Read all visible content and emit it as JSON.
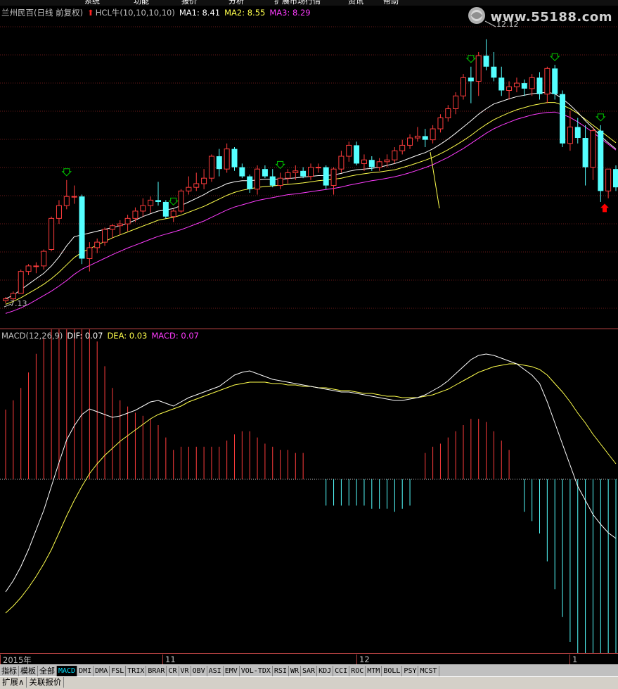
{
  "topbar": {
    "items": [
      "系统",
      "功能",
      "报价",
      "分析",
      "扩展市场行情",
      "资讯",
      "帮助"
    ]
  },
  "price_panel": {
    "stock_name": "兰州民百(日线 前复权)",
    "indicator": "HCL牛(10,10,10,10)",
    "ma1_label": "MA1: 8.41",
    "ma2_label": "MA2: 8.55",
    "ma3_label": "MA3: 8.29",
    "high_label": "12.12",
    "low_label": "7.13",
    "watermark": "www.55188.com"
  },
  "macd_panel": {
    "name": "MACD(12,26,9)",
    "dif_label": "DIF: 0.07",
    "dea_label": "DEA: 0.03",
    "macd_label": "MACD: 0.07"
  },
  "time_axis": {
    "labels": [
      "2015年",
      "11",
      "12",
      "1"
    ]
  },
  "tabs": [
    "指标",
    "模板",
    "全部",
    "MACD",
    "DMI",
    "DMA",
    "FSL",
    "TRIX",
    "BRAR",
    "CR",
    "VR",
    "OBV",
    "ASI",
    "EMV",
    "VOL-TDX",
    "RSI",
    "WR",
    "SAR",
    "KDJ",
    "CCI",
    "ROC",
    "MTM",
    "BOLL",
    "PSY",
    "MCST"
  ],
  "active_tab": "MACD",
  "bottom_buttons": [
    "扩展∧",
    "关联报价"
  ],
  "colors": {
    "up": "#ff3c3c",
    "down": "#54ffff",
    "ma1": "#ffffff",
    "ma2": "#ffff4c",
    "ma3": "#ff3cff",
    "grid": "#6a1a1a",
    "buy_arrow": "#00c800",
    "sell_arrow": "#ff0000"
  },
  "chart_data": [
    {
      "type": "candlestick",
      "title": "兰州民百(日线 前复权)",
      "candles": [
        [
          7.2,
          7.3,
          7.13,
          7.25
        ],
        [
          7.25,
          7.45,
          7.2,
          7.4
        ],
        [
          7.4,
          8.05,
          7.4,
          8.0
        ],
        [
          8.0,
          8.2,
          7.9,
          8.15
        ],
        [
          8.15,
          8.25,
          7.95,
          8.15
        ],
        [
          8.15,
          8.6,
          8.05,
          8.55
        ],
        [
          8.6,
          9.5,
          8.55,
          9.45
        ],
        [
          9.45,
          9.95,
          9.3,
          9.8
        ],
        [
          9.8,
          10.5,
          9.7,
          10.05
        ],
        [
          10.05,
          10.35,
          9.85,
          10.05
        ],
        [
          10.05,
          10.1,
          8.2,
          8.35
        ],
        [
          8.35,
          8.8,
          8.0,
          8.65
        ],
        [
          8.65,
          8.9,
          8.5,
          8.8
        ],
        [
          8.8,
          9.2,
          8.7,
          9.15
        ],
        [
          9.15,
          9.3,
          8.9,
          9.25
        ],
        [
          9.25,
          9.4,
          9.0,
          9.3
        ],
        [
          9.3,
          9.55,
          9.1,
          9.45
        ],
        [
          9.45,
          9.75,
          9.35,
          9.65
        ],
        [
          9.65,
          10.0,
          9.5,
          9.8
        ],
        [
          9.8,
          10.05,
          9.6,
          9.95
        ],
        [
          9.95,
          10.45,
          9.8,
          9.9
        ],
        [
          9.9,
          9.95,
          9.45,
          9.5
        ],
        [
          9.5,
          9.7,
          9.35,
          9.65
        ],
        [
          9.65,
          10.25,
          9.6,
          10.2
        ],
        [
          10.2,
          10.6,
          10.1,
          10.3
        ],
        [
          10.3,
          10.7,
          10.2,
          10.4
        ],
        [
          10.4,
          10.8,
          10.25,
          10.55
        ],
        [
          10.55,
          11.2,
          10.45,
          11.15
        ],
        [
          11.15,
          11.35,
          10.6,
          10.8
        ],
        [
          10.8,
          11.5,
          10.7,
          11.35
        ],
        [
          11.35,
          11.4,
          10.75,
          10.85
        ],
        [
          10.85,
          10.95,
          10.55,
          10.6
        ],
        [
          10.6,
          10.65,
          10.15,
          10.25
        ],
        [
          10.25,
          10.9,
          10.1,
          10.8
        ],
        [
          10.8,
          10.9,
          10.55,
          10.6
        ],
        [
          10.6,
          10.8,
          10.3,
          10.35
        ],
        [
          10.35,
          10.7,
          10.25,
          10.55
        ],
        [
          10.55,
          10.8,
          10.4,
          10.7
        ],
        [
          10.7,
          10.9,
          10.5,
          10.75
        ],
        [
          10.75,
          10.85,
          10.55,
          10.6
        ],
        [
          10.6,
          10.95,
          10.5,
          10.85
        ],
        [
          10.85,
          10.95,
          10.7,
          10.85
        ],
        [
          10.85,
          10.9,
          10.25,
          10.35
        ],
        [
          10.35,
          10.85,
          10.1,
          10.8
        ],
        [
          10.8,
          11.3,
          10.7,
          11.15
        ],
        [
          11.15,
          11.55,
          11.0,
          11.45
        ],
        [
          11.45,
          11.55,
          10.9,
          10.95
        ],
        [
          10.95,
          11.2,
          10.75,
          11.05
        ],
        [
          11.05,
          11.15,
          10.75,
          10.85
        ],
        [
          10.85,
          11.1,
          10.75,
          11.0
        ],
        [
          11.0,
          11.2,
          10.85,
          11.05
        ],
        [
          11.05,
          11.4,
          10.95,
          11.3
        ],
        [
          11.3,
          11.6,
          11.2,
          11.45
        ],
        [
          11.45,
          11.75,
          11.35,
          11.65
        ],
        [
          11.65,
          11.95,
          11.55,
          11.7
        ],
        [
          11.7,
          11.9,
          11.4,
          11.6
        ],
        [
          11.6,
          12.0,
          11.5,
          11.9
        ],
        [
          11.9,
          12.3,
          11.8,
          12.2
        ],
        [
          12.2,
          12.55,
          12.1,
          12.45
        ],
        [
          12.45,
          12.9,
          12.3,
          12.8
        ],
        [
          12.8,
          13.4,
          12.7,
          13.3
        ],
        [
          13.3,
          13.6,
          12.6,
          13.2
        ],
        [
          13.2,
          14.0,
          12.8,
          13.9
        ],
        [
          13.9,
          14.35,
          13.5,
          13.6
        ],
        [
          13.6,
          14.0,
          13.2,
          13.3
        ],
        [
          13.3,
          13.6,
          12.8,
          12.95
        ],
        [
          12.95,
          13.2,
          12.7,
          13.05
        ],
        [
          13.05,
          13.3,
          12.9,
          13.15
        ],
        [
          13.15,
          13.25,
          12.8,
          13.0
        ],
        [
          13.0,
          13.4,
          12.8,
          13.3
        ],
        [
          13.3,
          13.45,
          12.7,
          12.85
        ],
        [
          12.85,
          13.6,
          12.6,
          13.55
        ],
        [
          13.55,
          13.65,
          12.7,
          12.85
        ],
        [
          12.85,
          12.95,
          11.4,
          11.5
        ],
        [
          11.5,
          12.4,
          11.3,
          11.95
        ],
        [
          11.95,
          12.2,
          11.5,
          11.65
        ],
        [
          11.65,
          12.0,
          10.35,
          10.85
        ],
        [
          10.85,
          11.95,
          10.5,
          11.85
        ],
        [
          11.85,
          12.0,
          9.9,
          10.2
        ],
        [
          10.2,
          10.8,
          10.0,
          10.8
        ],
        [
          10.8,
          10.9,
          10.2,
          10.3
        ]
      ],
      "ma1": [
        7.25,
        7.35,
        7.5,
        7.65,
        7.8,
        7.95,
        8.15,
        8.4,
        8.7,
        8.95,
        9.0,
        9.05,
        9.1,
        9.15,
        9.2,
        9.25,
        9.32,
        9.4,
        9.5,
        9.58,
        9.65,
        9.68,
        9.72,
        9.8,
        9.9,
        10.0,
        10.1,
        10.22,
        10.3,
        10.4,
        10.45,
        10.48,
        10.48,
        10.5,
        10.52,
        10.52,
        10.52,
        10.54,
        10.56,
        10.58,
        10.6,
        10.62,
        10.62,
        10.64,
        10.68,
        10.74,
        10.78,
        10.8,
        10.82,
        10.85,
        10.9,
        10.95,
        11.02,
        11.1,
        11.18,
        11.25,
        11.35,
        11.48,
        11.62,
        11.78,
        11.95,
        12.12,
        12.3,
        12.45,
        12.58,
        12.65,
        12.72,
        12.78,
        12.82,
        12.86,
        12.88,
        12.9,
        12.86,
        12.72,
        12.55,
        12.35,
        12.12,
        11.92,
        11.7,
        11.52,
        11.35
      ],
      "ma2": [
        7.1,
        7.18,
        7.28,
        7.4,
        7.52,
        7.65,
        7.8,
        7.98,
        8.18,
        8.38,
        8.52,
        8.62,
        8.72,
        8.82,
        8.92,
        9.0,
        9.08,
        9.16,
        9.24,
        9.32,
        9.4,
        9.44,
        9.48,
        9.54,
        9.62,
        9.7,
        9.78,
        9.88,
        9.98,
        10.08,
        10.16,
        10.22,
        10.26,
        10.3,
        10.32,
        10.34,
        10.36,
        10.38,
        10.4,
        10.42,
        10.45,
        10.48,
        10.5,
        10.52,
        10.55,
        10.6,
        10.64,
        10.67,
        10.7,
        10.72,
        10.75,
        10.78,
        10.84,
        10.9,
        10.97,
        11.04,
        11.12,
        11.22,
        11.33,
        11.45,
        11.58,
        11.72,
        11.88,
        12.02,
        12.15,
        12.25,
        12.34,
        12.42,
        12.48,
        12.54,
        12.58,
        12.62,
        12.62,
        12.55,
        12.45,
        12.32,
        12.16,
        12.0,
        11.84,
        11.68,
        11.52
      ],
      "ma3": [
        6.85,
        6.92,
        7.0,
        7.1,
        7.22,
        7.34,
        7.46,
        7.6,
        7.75,
        7.92,
        8.06,
        8.16,
        8.26,
        8.36,
        8.46,
        8.55,
        8.64,
        8.72,
        8.8,
        8.88,
        8.96,
        9.02,
        9.08,
        9.14,
        9.22,
        9.3,
        9.38,
        9.48,
        9.58,
        9.68,
        9.76,
        9.82,
        9.88,
        9.94,
        9.98,
        10.02,
        10.06,
        10.1,
        10.12,
        10.15,
        10.18,
        10.21,
        10.24,
        10.27,
        10.31,
        10.36,
        10.4,
        10.44,
        10.48,
        10.51,
        10.55,
        10.59,
        10.64,
        10.7,
        10.77,
        10.84,
        10.92,
        11.02,
        11.12,
        11.24,
        11.36,
        11.5,
        11.64,
        11.78,
        11.9,
        12.0,
        12.08,
        12.16,
        12.22,
        12.28,
        12.32,
        12.35,
        12.36,
        12.3,
        12.21,
        12.09,
        11.95,
        11.8,
        11.64,
        11.48,
        11.32
      ],
      "signals": [
        [
          8,
          "buy"
        ],
        [
          36,
          "buy"
        ],
        [
          61,
          "buy"
        ],
        [
          72,
          "buy"
        ],
        [
          78,
          "buy"
        ],
        [
          103,
          "buy"
        ],
        [
          127,
          "sell"
        ]
      ],
      "price_range": [
        6.8,
        15.0
      ],
      "high": 12.12,
      "low": 7.13
    },
    {
      "type": "line+bar",
      "title": "MACD(12,26,9)",
      "dif": [
        -0.8,
        -0.72,
        -0.62,
        -0.5,
        -0.36,
        -0.22,
        -0.05,
        0.12,
        0.28,
        0.38,
        0.46,
        0.5,
        0.48,
        0.46,
        0.44,
        0.45,
        0.47,
        0.49,
        0.52,
        0.55,
        0.56,
        0.54,
        0.52,
        0.55,
        0.58,
        0.6,
        0.62,
        0.64,
        0.66,
        0.7,
        0.74,
        0.76,
        0.77,
        0.75,
        0.73,
        0.71,
        0.7,
        0.69,
        0.68,
        0.67,
        0.66,
        0.65,
        0.64,
        0.63,
        0.62,
        0.62,
        0.61,
        0.6,
        0.59,
        0.58,
        0.57,
        0.56,
        0.56,
        0.57,
        0.58,
        0.6,
        0.63,
        0.66,
        0.7,
        0.75,
        0.8,
        0.85,
        0.88,
        0.89,
        0.88,
        0.86,
        0.84,
        0.82,
        0.78,
        0.74,
        0.68,
        0.55,
        0.4,
        0.25,
        0.1,
        -0.05,
        -0.15,
        -0.25,
        -0.32,
        -0.38,
        -0.42
      ],
      "dea": [
        -0.95,
        -0.9,
        -0.84,
        -0.77,
        -0.69,
        -0.6,
        -0.5,
        -0.38,
        -0.26,
        -0.15,
        -0.05,
        0.04,
        0.11,
        0.17,
        0.22,
        0.27,
        0.31,
        0.35,
        0.39,
        0.43,
        0.46,
        0.48,
        0.5,
        0.52,
        0.55,
        0.57,
        0.59,
        0.61,
        0.63,
        0.65,
        0.67,
        0.68,
        0.69,
        0.69,
        0.69,
        0.68,
        0.68,
        0.67,
        0.67,
        0.66,
        0.66,
        0.65,
        0.65,
        0.64,
        0.63,
        0.63,
        0.62,
        0.61,
        0.61,
        0.6,
        0.59,
        0.59,
        0.58,
        0.58,
        0.58,
        0.59,
        0.6,
        0.62,
        0.64,
        0.67,
        0.7,
        0.73,
        0.76,
        0.78,
        0.8,
        0.81,
        0.82,
        0.82,
        0.81,
        0.8,
        0.78,
        0.74,
        0.68,
        0.62,
        0.55,
        0.47,
        0.4,
        0.32,
        0.25,
        0.18,
        0.11
      ],
      "ylim": [
        -1.0,
        1.0
      ]
    }
  ]
}
